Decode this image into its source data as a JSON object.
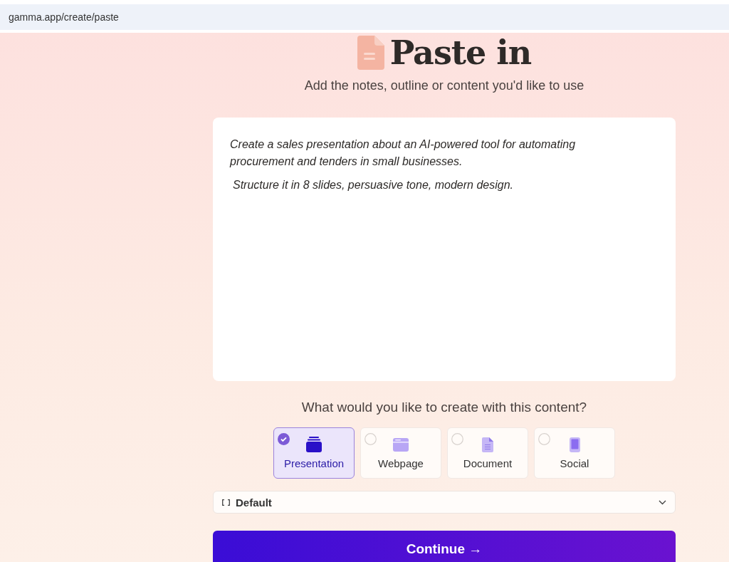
{
  "address_bar": {
    "url": "gamma.app/create/paste"
  },
  "header": {
    "title": "Paste in",
    "subtitle": "Add the notes, outline or content you'd like to use"
  },
  "editor": {
    "paragraphs": [
      "Create a sales presentation about an AI-powered tool for automating procurement and tenders in small businesses.",
      "Structure it in 8 slides, persuasive tone, modern design."
    ]
  },
  "question": "What would you like to create with this content?",
  "options": [
    {
      "label": "Presentation",
      "kind": "presentation",
      "selected": true
    },
    {
      "label": "Webpage",
      "kind": "webpage",
      "selected": false
    },
    {
      "label": "Document",
      "kind": "document",
      "selected": false
    },
    {
      "label": "Social",
      "kind": "social",
      "selected": false
    }
  ],
  "format_select": {
    "value": "Default"
  },
  "continue_button": {
    "label": "Continue →"
  }
}
